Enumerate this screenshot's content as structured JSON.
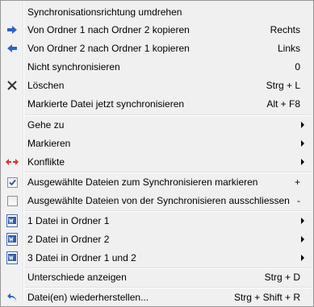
{
  "menu": {
    "items": [
      {
        "label": "Synchronisationsrichtung umdrehen",
        "shortcut": "",
        "icon": "none",
        "submenu": false
      },
      {
        "label": "Von Ordner 1 nach Ordner 2 kopieren",
        "shortcut": "Rechts",
        "icon": "arrow-right-icon",
        "submenu": false
      },
      {
        "label": "Von Ordner 2 nach Ordner 1 kopieren",
        "shortcut": "Links",
        "icon": "arrow-left-icon",
        "submenu": false
      },
      {
        "label": "Nicht synchronisieren",
        "shortcut": "0",
        "icon": "none",
        "submenu": false
      },
      {
        "label": "Löschen",
        "shortcut": "Strg + L",
        "icon": "delete-x-icon",
        "submenu": false
      },
      {
        "label": "Markierte Datei jetzt synchronisieren",
        "shortcut": "Alt + F8",
        "icon": "none",
        "submenu": false
      },
      {
        "label": "Gehe zu",
        "shortcut": "",
        "icon": "none",
        "submenu": true
      },
      {
        "label": "Markieren",
        "shortcut": "",
        "icon": "none",
        "submenu": true
      },
      {
        "label": "Konflikte",
        "shortcut": "",
        "icon": "conflict-arrows-icon",
        "submenu": true
      },
      {
        "label": "Ausgewählte Dateien zum Synchronisieren markieren",
        "shortcut": "+",
        "icon": "checkbox-checked-icon",
        "submenu": false
      },
      {
        "label": "Ausgewählte Dateien von der Synchronisieren ausschliessen",
        "shortcut": "-",
        "icon": "checkbox-empty-icon",
        "submenu": false
      },
      {
        "label": "1 Datei in Ordner 1",
        "shortcut": "",
        "icon": "document-icon",
        "submenu": true
      },
      {
        "label": "2 Datei in Ordner 2",
        "shortcut": "",
        "icon": "document-icon",
        "submenu": true
      },
      {
        "label": "3 Datei in Ordner 1 und 2",
        "shortcut": "",
        "icon": "document-icon",
        "submenu": true
      },
      {
        "label": "Unterschiede anzeigen",
        "shortcut": "Strg + D",
        "icon": "none",
        "submenu": false
      },
      {
        "label": "Datei(en) wiederherstellen...",
        "shortcut": "Strg + Shift + R",
        "icon": "undo-icon",
        "submenu": false
      }
    ]
  },
  "colors": {
    "menu_bg": "#f0f0f0",
    "border": "#979797",
    "arrow_blue": "#2a63c9",
    "conflict_red": "#d9332c"
  }
}
